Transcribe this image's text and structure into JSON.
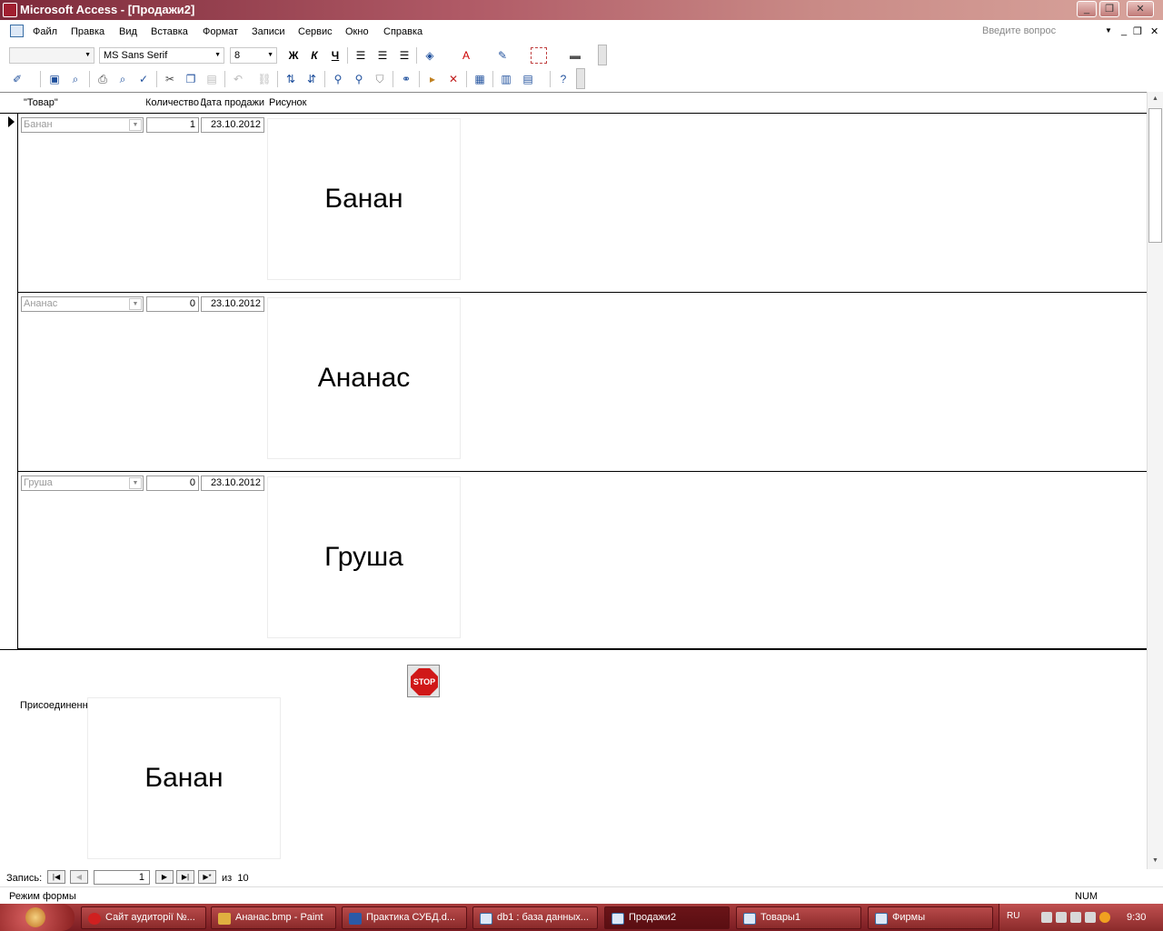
{
  "window": {
    "title": "Microsoft Access - [Продажи2]"
  },
  "menu": {
    "items": [
      "Файл",
      "Правка",
      "Вид",
      "Вставка",
      "Формат",
      "Записи",
      "Сервис",
      "Окно",
      "Справка"
    ],
    "ask_placeholder": "Введите вопрос"
  },
  "toolbar": {
    "font_name": "MS Sans Serif",
    "font_size": "8",
    "bold": "Ж",
    "italic": "К",
    "underline": "Ч"
  },
  "columns": [
    "\"Товар\"",
    "Количество",
    "Дата продажи",
    "Рисунок"
  ],
  "records": [
    {
      "product": "Банан",
      "qty": "1",
      "date": "23.10.2012",
      "picture_text": "Банан"
    },
    {
      "product": "Ананас",
      "qty": "0",
      "date": "23.10.2012",
      "picture_text": "Ананас"
    },
    {
      "product": "Груша",
      "qty": "0",
      "date": "23.10.2012",
      "picture_text": "Груша"
    }
  ],
  "footer": {
    "stop_label": "STOP",
    "attached_label": "Присоединенный",
    "attached_picture_text": "Банан"
  },
  "navigation": {
    "label": "Запись:",
    "current": "1",
    "of_label": "из",
    "total": "10"
  },
  "status": {
    "mode": "Режим формы",
    "num": "NUM"
  },
  "taskbar": {
    "tasks": [
      {
        "label": "Сайт аудиторії №...",
        "icon_color": "#d02020"
      },
      {
        "label": "Ананас.bmp - Paint",
        "icon_color": "#e0b040"
      },
      {
        "label": "Практика СУБД.d...",
        "icon_color": "#2a5aa8"
      },
      {
        "label": "db1 : база данных...",
        "icon_color": "#b04050"
      },
      {
        "label": "Продажи2",
        "icon_color": "#b04050"
      },
      {
        "label": "Товары1",
        "icon_color": "#b04050"
      },
      {
        "label": "Фирмы",
        "icon_color": "#b04050"
      }
    ],
    "lang": "RU",
    "clock": "9:30"
  }
}
